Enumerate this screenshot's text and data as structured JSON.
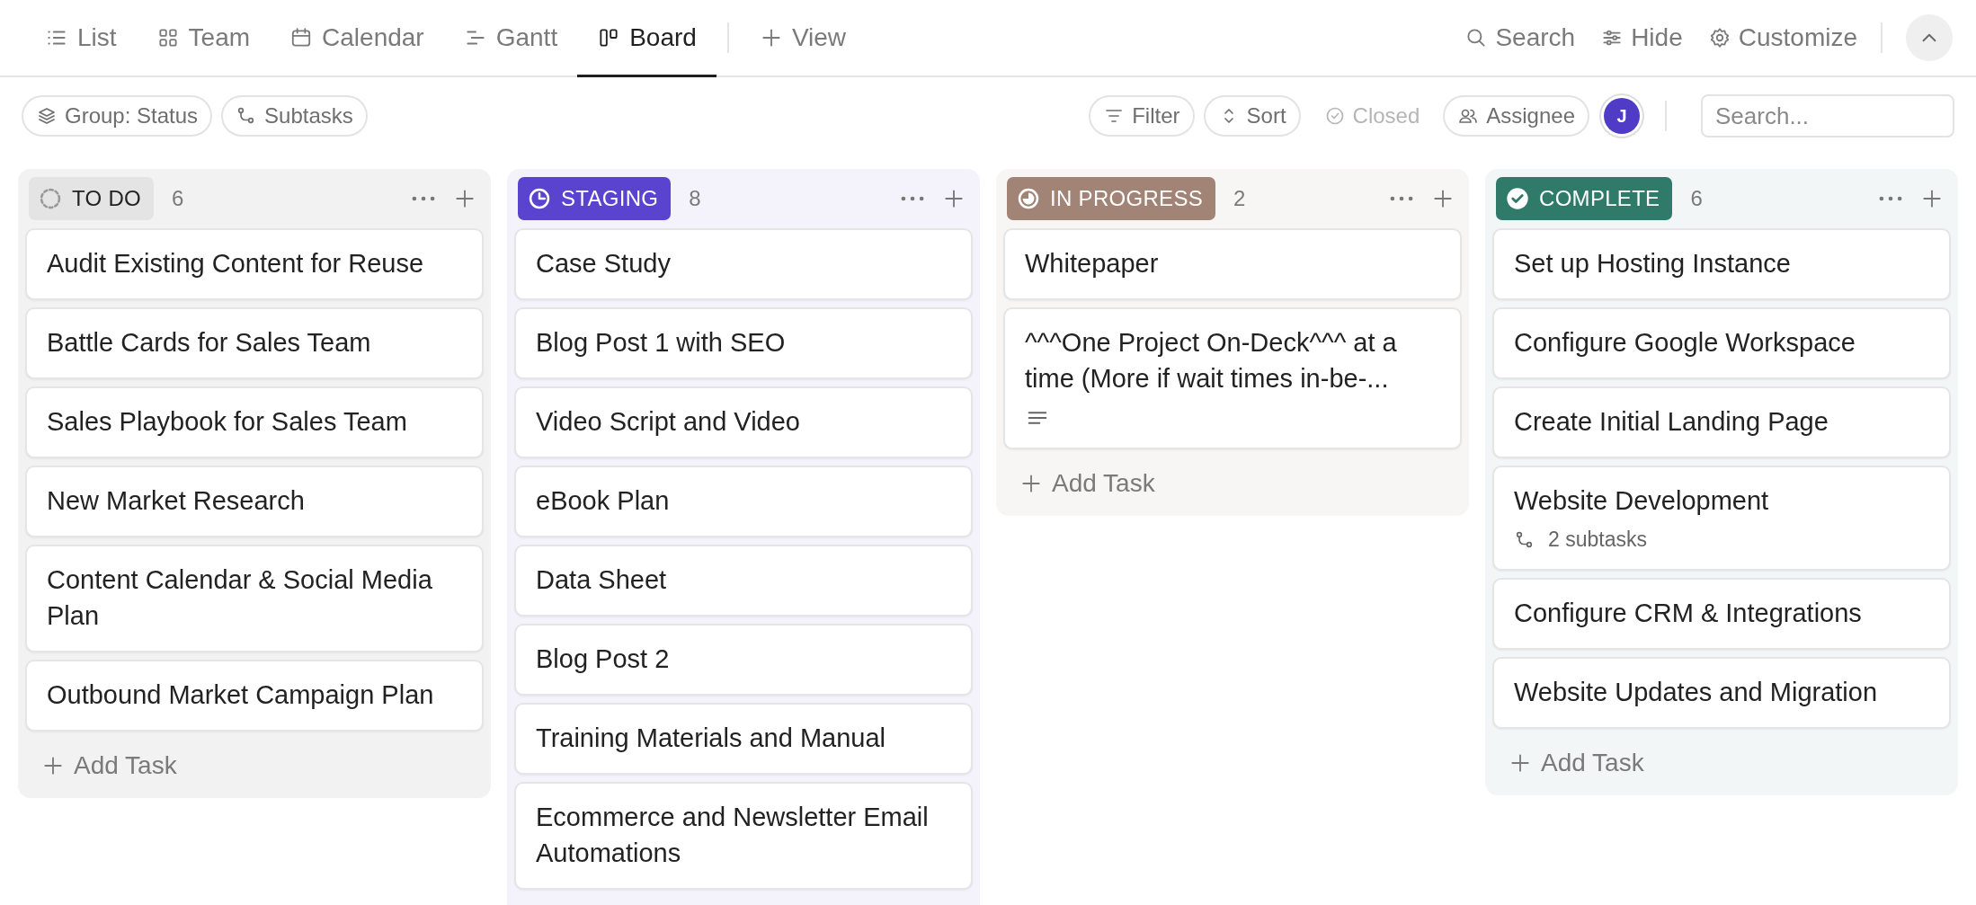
{
  "view_tabs": [
    {
      "label": "List",
      "kind": "list",
      "selected": false
    },
    {
      "label": "Team",
      "kind": "team",
      "selected": false
    },
    {
      "label": "Calendar",
      "kind": "calendar",
      "selected": false
    },
    {
      "label": "Gantt",
      "kind": "gantt",
      "selected": false
    },
    {
      "label": "Board",
      "kind": "board",
      "selected": true
    }
  ],
  "add_view": "View",
  "header_actions": [
    {
      "label": "Search",
      "kind": "search"
    },
    {
      "label": "Hide",
      "kind": "sliders"
    },
    {
      "label": "Customize",
      "kind": "gear"
    }
  ],
  "filter_chips_left": [
    {
      "label": "Group: Status",
      "kind": "layers"
    },
    {
      "label": "Subtasks",
      "kind": "subtasks"
    }
  ],
  "filter_chips_right": [
    {
      "label": "Filter",
      "kind": "filter",
      "disabled": false
    },
    {
      "label": "Sort",
      "kind": "sort",
      "disabled": false
    },
    {
      "label": "Closed",
      "kind": "check",
      "disabled": true
    },
    {
      "label": "Assignee",
      "kind": "people",
      "disabled": false
    }
  ],
  "avatar": {
    "initial": "J"
  },
  "search": {
    "placeholder": "Search..."
  },
  "columns": [
    {
      "status": "TO DO",
      "kind": "todo",
      "color": "#e4e4e4",
      "count": "6",
      "add_task": "Add Task",
      "cards": [
        {
          "title": "Audit Existing Content for Reuse",
          "kind": "plain"
        },
        {
          "title": "Battle Cards for Sales Team",
          "kind": "plain"
        },
        {
          "title": "Sales Playbook for Sales Team",
          "kind": "plain"
        },
        {
          "title": "New Market Research",
          "kind": "plain"
        },
        {
          "title": "Content Calendar & Social Media Plan",
          "kind": "plain"
        },
        {
          "title": "Outbound Market Campaign Plan",
          "kind": "plain"
        }
      ]
    },
    {
      "status": "STAGING",
      "kind": "staging",
      "color": "#5a43cf",
      "count": "8",
      "cards": [
        {
          "title": "Case Study",
          "kind": "plain"
        },
        {
          "title": "Blog Post 1 with SEO",
          "kind": "plain"
        },
        {
          "title": "Video Script and Video",
          "kind": "plain"
        },
        {
          "title": "eBook Plan",
          "kind": "plain"
        },
        {
          "title": "Data Sheet",
          "kind": "plain"
        },
        {
          "title": "Blog Post 2",
          "kind": "plain"
        },
        {
          "title": "Training Materials and Manual",
          "kind": "plain"
        },
        {
          "title": "Ecommerce and Newsletter Email Automations",
          "kind": "plain"
        }
      ]
    },
    {
      "status": "IN PROGRESS",
      "kind": "progress",
      "color": "#a18476",
      "count": "2",
      "add_task": "Add Task",
      "cards": [
        {
          "title": "Whitepaper",
          "kind": "plain"
        },
        {
          "title": "^^^One Project On-Deck^^^ at a time (More if wait times in-be-...",
          "kind": "description"
        }
      ]
    },
    {
      "status": "COMPLETE",
      "kind": "complete",
      "color": "#2f7a69",
      "count": "6",
      "add_task": "Add Task",
      "cards": [
        {
          "title": "Set up Hosting Instance",
          "kind": "plain"
        },
        {
          "title": "Configure Google Workspace",
          "kind": "plain"
        },
        {
          "title": "Create Initial Landing Page",
          "kind": "plain"
        },
        {
          "title": "Website Development",
          "kind": "subtasks",
          "subtasks": "2 subtasks"
        },
        {
          "title": "Configure CRM & Integrations",
          "kind": "plain"
        },
        {
          "title": "Website Updates and Migration",
          "kind": "plain"
        }
      ]
    }
  ]
}
